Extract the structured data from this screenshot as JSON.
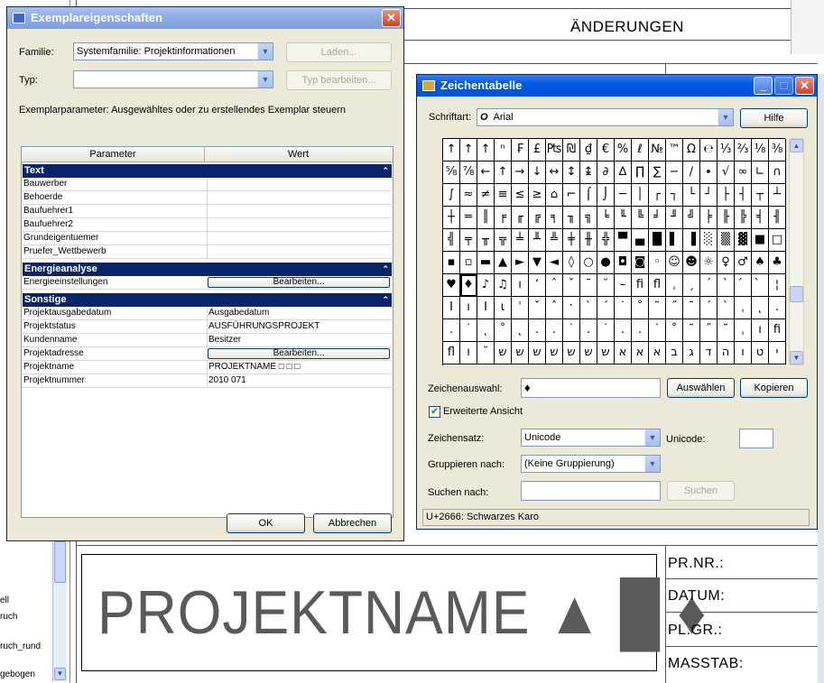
{
  "background": {
    "aenderungen_title": "ÄNDERUNGEN",
    "big_projektname": "PROJEKTNAME ▲ █ ♦",
    "title_labels": [
      "PR.NR.:",
      "DATUM:",
      "PL.GR.:",
      "MASSTAB:"
    ],
    "left_labels": [
      "ell",
      "ruch",
      "ruch_rund",
      "gebogen"
    ]
  },
  "exemplar": {
    "title": "Exemplareigenschaften",
    "close_glyph": "✕",
    "familie_label": "Familie:",
    "familie_value": "Systemfamilie: Projektinformationen",
    "typ_label": "Typ:",
    "typ_value": "",
    "laden_button": "Laden...",
    "typ_bearbeiten_button": "Typ bearbeiten...",
    "instruction": "Exemplarparameter: Ausgewähltes oder zu erstellendes Exemplar steuern",
    "col_parameter": "Parameter",
    "col_wert": "Wert",
    "collapse_glyph": "⌃",
    "groups": {
      "text": {
        "label": "Text",
        "rows": [
          {
            "param": "Bauwerber",
            "value": ""
          },
          {
            "param": "Behoerde",
            "value": ""
          },
          {
            "param": "Baufuehrer1",
            "value": ""
          },
          {
            "param": "Baufuehrer2",
            "value": ""
          },
          {
            "param": "Grundeigentuemer",
            "value": ""
          },
          {
            "param": "Pruefer_Wettbewerb",
            "value": ""
          }
        ]
      },
      "energie": {
        "label": "Energieanalyse",
        "rows": [
          {
            "param": "Energieeinstellungen",
            "value": "Bearbeiten..."
          }
        ]
      },
      "sonstige": {
        "label": "Sonstige",
        "rows": [
          {
            "param": "Projektausgabedatum",
            "value": "Ausgabedatum"
          },
          {
            "param": "Projektstatus",
            "value": "AUSFÜHRUNGSPROJEKT"
          },
          {
            "param": "Kundenname",
            "value": "Besitzer"
          },
          {
            "param": "Projektadresse",
            "value": "Bearbeiten..."
          },
          {
            "param": "Projektname",
            "value": "PROJEKTNAME □ □ □"
          },
          {
            "param": "Projektnummer",
            "value": "2010 071"
          }
        ]
      }
    },
    "ok_button": "OK",
    "abbrechen_button": "Abbrechen"
  },
  "charmap": {
    "title": "Zeichentabelle",
    "schriftart_label": "Schriftart:",
    "font_icon": "O",
    "schriftart_value": "Arial",
    "hilfe_button": "Hilfe",
    "rows": [
      [
        "↑",
        "↑",
        "↑",
        "ⁿ",
        "₣",
        "£",
        "₧",
        "₪",
        "₫",
        "€",
        "%",
        "ℓ",
        "№",
        "™",
        "Ω",
        "℮",
        "⅓",
        "⅔",
        "⅛",
        "⅜"
      ],
      [
        "⅝",
        "⅞",
        "←",
        "↑",
        "→",
        "↓",
        "↔",
        "↕",
        "↨",
        "∂",
        "∆",
        "∏",
        "∑",
        "−",
        "∕",
        "∙",
        "√",
        "∞",
        "∟",
        "∩"
      ],
      [
        "∫",
        "≈",
        "≠",
        "≡",
        "≤",
        "≥",
        "⌂",
        "⌐",
        "⌠",
        "⌡",
        "─",
        "│",
        "┌",
        "┐",
        "└",
        "┘",
        "├",
        "┤",
        "┬",
        "┴"
      ],
      [
        "┼",
        "═",
        "║",
        "╒",
        "╓",
        "╔",
        "╕",
        "╖",
        "╗",
        "╘",
        "╙",
        "╚",
        "╛",
        "╜",
        "╝",
        "╞",
        "╟",
        "╠",
        "╡",
        "╢"
      ],
      [
        "╣",
        "╤",
        "╥",
        "╦",
        "╧",
        "╨",
        "╩",
        "╪",
        "╫",
        "╬",
        "▀",
        "▄",
        "█",
        "▌",
        "▐",
        "░",
        "▒",
        "▓",
        "■",
        "□"
      ],
      [
        "▪",
        "▫",
        "▬",
        "▲",
        "►",
        "▼",
        "◄",
        "◊",
        "○",
        "●",
        "◘",
        "◙",
        "◦",
        "☺",
        "☻",
        "☼",
        "♀",
        "♂",
        "♠",
        "♣"
      ],
      [
        "♥",
        "♦",
        "♪",
        "♫",
        "ı",
        "ʼ",
        "ˆ",
        "ˇ",
        "ˉ",
        "˘",
        "–",
        "ﬁ",
        "ﬂ",
        "ˌ",
        "ˏ",
        "ˊ",
        "ˋ",
        "́",
        "̀",
        "¦"
      ],
      [
        "Ι",
        "ı",
        "Ι",
        "ι",
        "ˈ",
        "ˇ",
        "ˆ",
        "ˑ",
        "ˋ",
        "ˊ",
        "˙",
        "˚",
        "˜",
        "˝",
        "ˉ",
        "ˊ",
        "ˋ",
        "ˌ",
        "˛",
        "."
      ],
      [
        ".",
        "˙",
        "˛",
        "˚",
        "˛",
        ".",
        ".",
        "˙",
        ".",
        "˙",
        ".",
        ".",
        "˙",
        "˚",
        "˜",
        "˝",
        "˜",
        "ˌ",
        "ı",
        "ﬁ"
      ],
      [
        "ﬂ",
        "ı",
        "˘",
        "ש",
        "ש",
        "ש",
        "ש",
        "ש",
        "ש",
        "ש",
        "א",
        "א",
        "א",
        "ב",
        "ג",
        "ד",
        "ה",
        "ו",
        "ט",
        "י"
      ]
    ],
    "selected_row": 6,
    "selected_col": 1,
    "zeichenauswahl_label": "Zeichenauswahl:",
    "zeichenauswahl_value": "♦",
    "auswaehlen_button": "Auswählen",
    "kopieren_button": "Kopieren",
    "erweiterte_label": "Erweiterte Ansicht",
    "erweiterte_checked": "✔",
    "zeichensatz_label": "Zeichensatz:",
    "zeichensatz_value": "Unicode",
    "unicode_label": "Unicode:",
    "unicode_value": "",
    "gruppieren_label": "Gruppieren nach:",
    "gruppieren_value": "(Keine Gruppierung)",
    "suchen_label": "Suchen nach:",
    "suchen_value": "",
    "suchen_button": "Suchen",
    "status": "U+2666: Schwarzes Karo",
    "min_glyph": "_",
    "max_glyph": "□",
    "close_glyph": "✕"
  }
}
